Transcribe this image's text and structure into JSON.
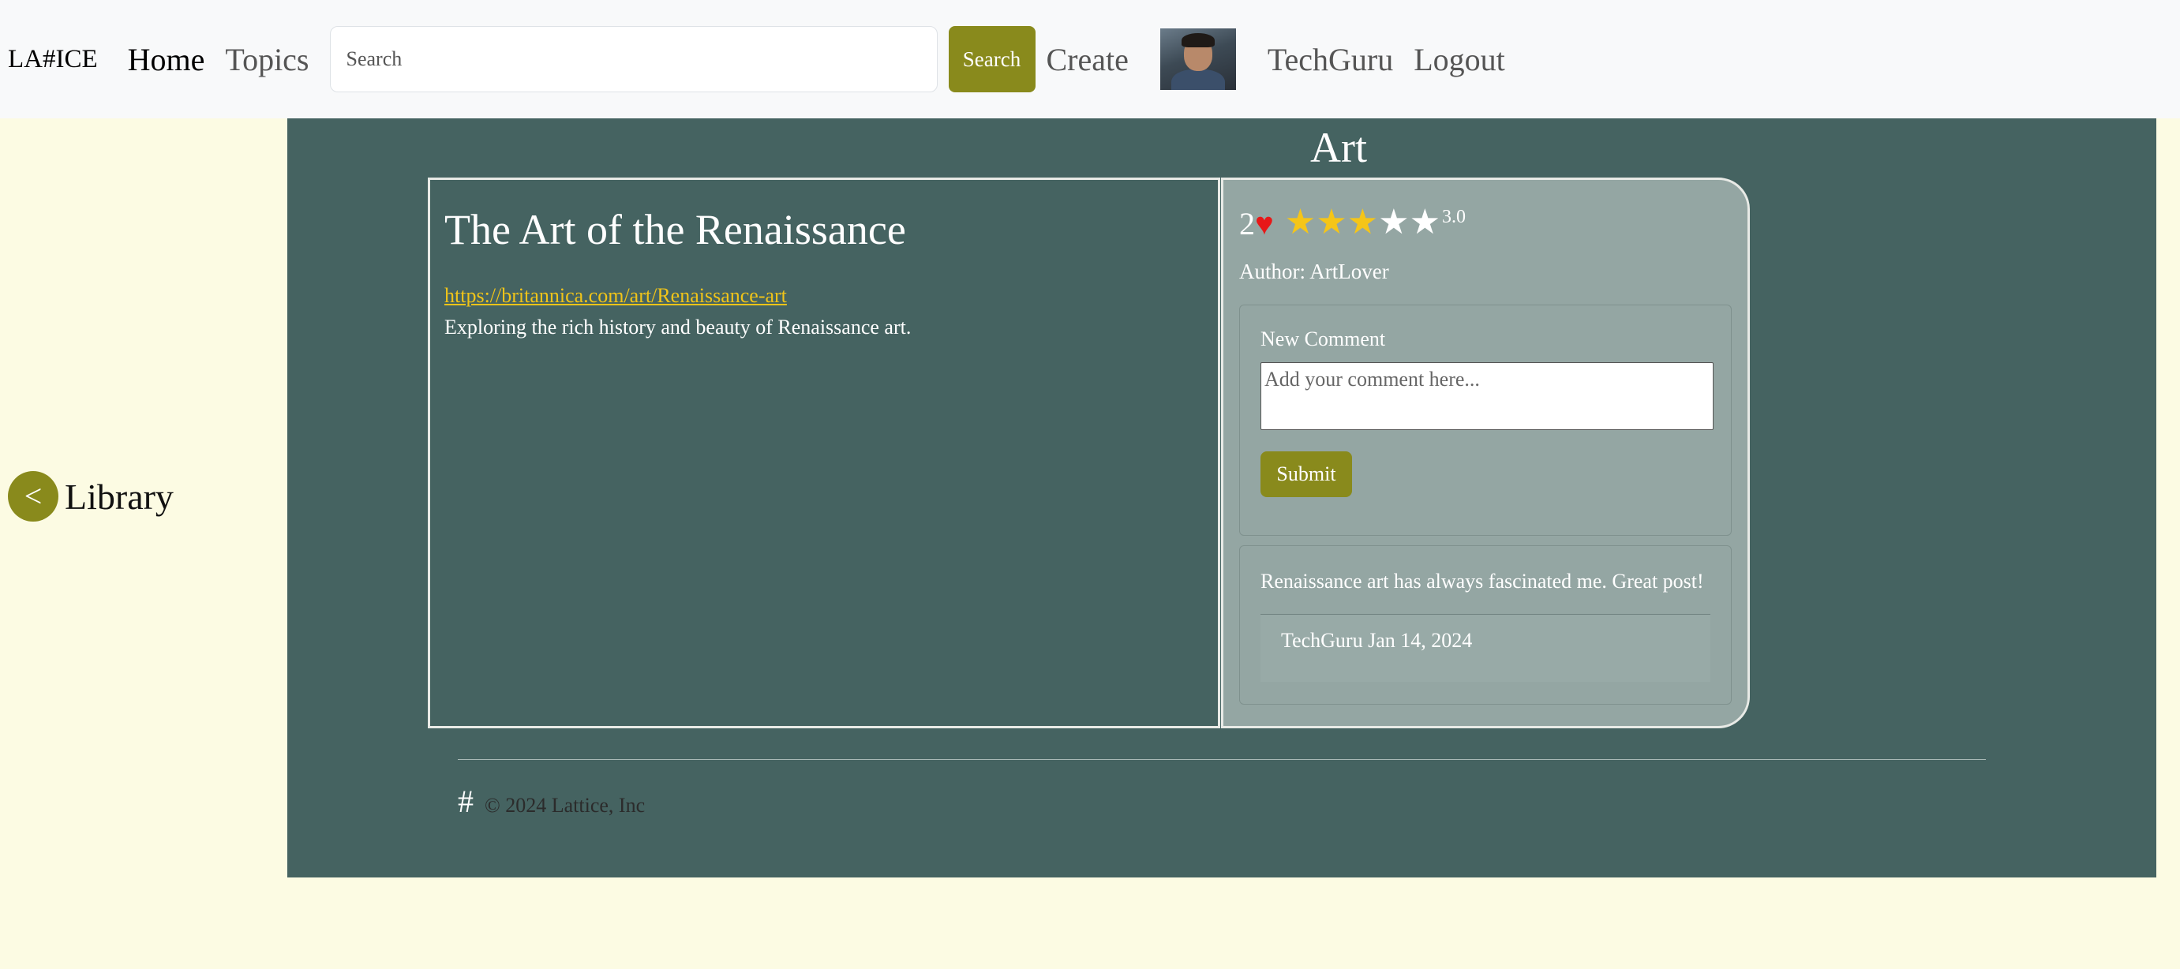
{
  "navbar": {
    "brand": "LA#ICE",
    "home": "Home",
    "topics": "Topics",
    "search_placeholder": "Search",
    "search_button": "Search",
    "create": "Create",
    "username": "TechGuru",
    "logout": "Logout"
  },
  "sidebar": {
    "back_icon": "<",
    "label": "Library"
  },
  "topic": {
    "title": "Art"
  },
  "post": {
    "title": "The Art of the Renaissance",
    "link": "https://britannica.com/art/Renaissance-art",
    "description": "Exploring the rich history and beauty of Renaissance art.",
    "likes": "2",
    "heart": "♥",
    "rating": "3.0",
    "rating_stars": 3,
    "max_stars": 5,
    "author": "Author: ArtLover"
  },
  "comment_form": {
    "label": "New Comment",
    "placeholder": "Add your comment here...",
    "submit": "Submit"
  },
  "comments": [
    {
      "body": "Renaissance art has always fascinated me. Great post!",
      "meta": "TechGuru Jan 14, 2024"
    }
  ],
  "footer": {
    "icon": "#",
    "copyright": "© 2024 Lattice, Inc"
  },
  "colors": {
    "accent": "#898a1c",
    "panel": "#456361",
    "side_card": "#94a6a3",
    "page_bg": "#fcfbe3",
    "star_on": "#f5c518",
    "heart": "#e81818",
    "link": "#f0c419"
  }
}
